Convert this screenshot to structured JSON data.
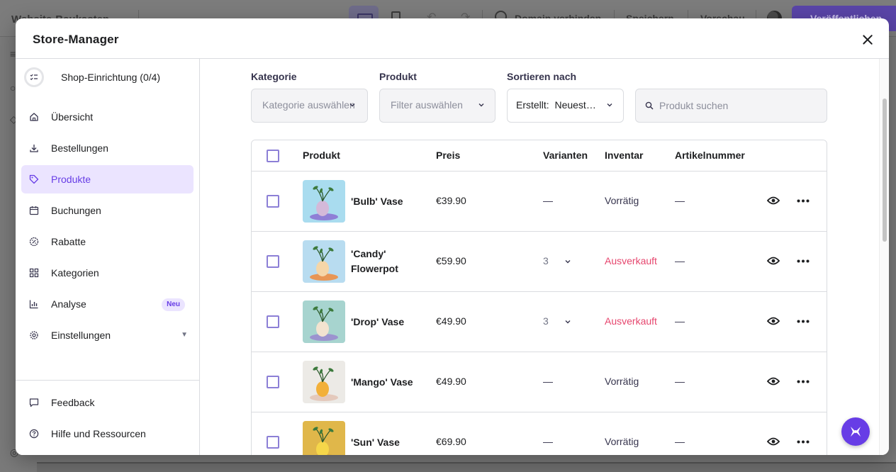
{
  "background": {
    "site_title": "Website-Baukasten",
    "domain_label": "Domain verbinden",
    "save_label": "Speichern",
    "preview_label": "Vorschau",
    "publish_label": "Veröffentlichen"
  },
  "modal": {
    "title": "Store-Manager"
  },
  "sidebar": {
    "setup_label": "Shop-Einrichtung (0/4)",
    "items": [
      {
        "label": "Übersicht",
        "icon": "home-icon"
      },
      {
        "label": "Bestellungen",
        "icon": "download-icon"
      },
      {
        "label": "Produkte",
        "icon": "tag-icon",
        "active": true
      },
      {
        "label": "Buchungen",
        "icon": "calendar-icon"
      },
      {
        "label": "Rabatte",
        "icon": "discount-icon"
      },
      {
        "label": "Kategorien",
        "icon": "grid-icon"
      },
      {
        "label": "Analyse",
        "icon": "chart-icon",
        "badge": "Neu"
      },
      {
        "label": "Einstellungen",
        "icon": "gear-icon"
      }
    ],
    "footer": [
      {
        "label": "Feedback",
        "icon": "chat-icon"
      },
      {
        "label": "Hilfe und Ressourcen",
        "icon": "help-icon"
      }
    ]
  },
  "filters": {
    "category_label": "Kategorie",
    "category_placeholder": "Kategorie auswählen",
    "product_label": "Produkt",
    "product_placeholder": "Filter auswählen",
    "sort_label": "Sortieren nach",
    "sort_value": "Erstellt:  Neueste zuerst",
    "search_placeholder": "Produkt suchen"
  },
  "table": {
    "columns": [
      "Produkt",
      "Preis",
      "Varianten",
      "Inventar",
      "Artikelnummer"
    ],
    "rows": [
      {
        "name": "'Bulb' Vase",
        "price": "€39.90",
        "variants": "—",
        "inventory": "Vorrätig",
        "sku": "—",
        "thumb_colors": [
          "#a9dcef",
          "#d4b9d9",
          "#8b6ed1"
        ]
      },
      {
        "name": "'Candy' Flowerpot",
        "price": "€59.90",
        "variants": "3",
        "inventory": "Ausverkauft",
        "sku": "—",
        "thumb_colors": [
          "#b8dcf0",
          "#f5d6a8",
          "#f08a3a"
        ]
      },
      {
        "name": "'Drop' Vase",
        "price": "€49.90",
        "variants": "3",
        "inventory": "Ausverkauft",
        "sku": "—",
        "thumb_colors": [
          "#a7d4cf",
          "#f2e3d0",
          "#9a87cf"
        ]
      },
      {
        "name": "'Mango' Vase",
        "price": "€49.90",
        "variants": "—",
        "inventory": "Vorrätig",
        "sku": "—",
        "thumb_colors": [
          "#eceae6",
          "#f2b03a",
          "#e3c3b4"
        ]
      },
      {
        "name": "'Sun' Vase",
        "price": "€69.90",
        "variants": "—",
        "inventory": "Vorrätig",
        "sku": "—",
        "thumb_colors": [
          "#e0b74a",
          "#f5d64a",
          "#d9a52e"
        ]
      }
    ]
  },
  "colors": {
    "accent": "#673de6",
    "accent_light": "#ebe4ff",
    "out_of_stock": "#e6466e"
  }
}
